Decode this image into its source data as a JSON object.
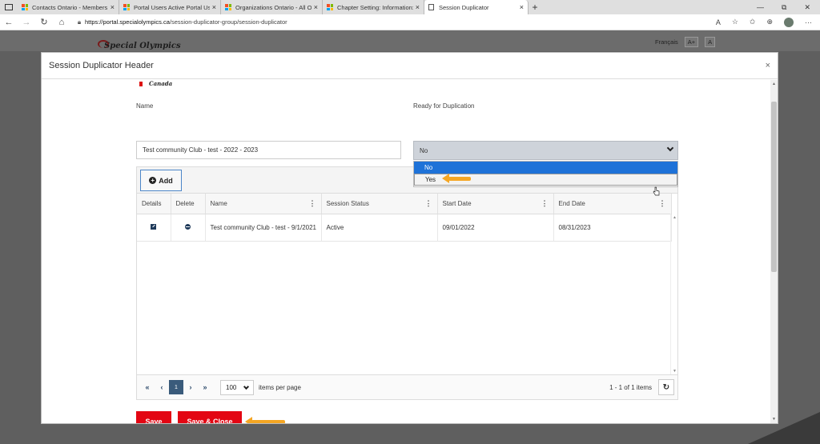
{
  "browser": {
    "tabs": [
      {
        "title": "Contacts Ontario - Members - D",
        "active": false
      },
      {
        "title": "Portal Users Active Portal Users",
        "active": false
      },
      {
        "title": "Organizations Ontario - All Orga",
        "active": false
      },
      {
        "title": "Chapter Setting: Information: vlC",
        "active": false
      },
      {
        "title": "Session Duplicator",
        "active": true
      }
    ],
    "url_scheme_host": "https://portal.specialolympics.ca",
    "url_path": "/session-duplicator-group/session-duplicator"
  },
  "page": {
    "logo_text": "Special Olympics",
    "lang_link": "Français",
    "font_larger": "A+",
    "font_smaller": "A"
  },
  "modal": {
    "title": "Session Duplicator Header",
    "close": "×",
    "logo_fragment": "Canada",
    "name_label": "Name",
    "name_value": "Test community Club - test - 2022 - 2023",
    "ready_label": "Ready for Duplication",
    "ready_value": "No",
    "dropdown_options": [
      "No",
      "Yes"
    ],
    "add_label": "Add",
    "columns": [
      "Details",
      "Delete",
      "Name",
      "Session Status",
      "Start Date",
      "End Date"
    ],
    "rows": [
      {
        "name": "Test community Club - test - 9/1/2021",
        "status": "Active",
        "start": "09/01/2022",
        "end": "08/31/2023"
      }
    ],
    "pager": {
      "current_page": "1",
      "per_page": "100",
      "per_page_label": "items per page",
      "info": "1 - 1 of 1 items"
    },
    "save_label": "Save",
    "save_close_label": "Save & Close"
  },
  "colors": {
    "primary_red": "#e30613",
    "dropdown_selected": "#1e72d8",
    "annotation_arrow": "#f5a623"
  }
}
